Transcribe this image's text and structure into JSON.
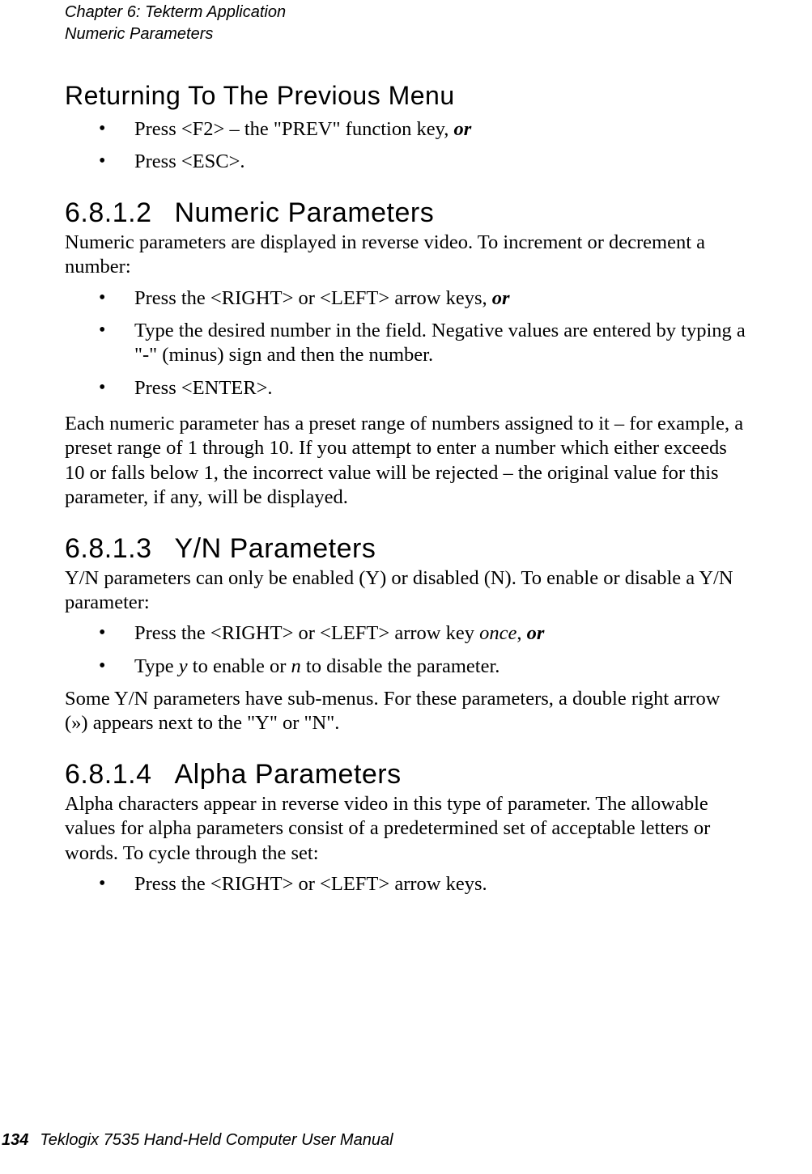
{
  "header": {
    "chapter": "Chapter  6:   Tekterm Application",
    "section": "Numeric Parameters"
  },
  "s_return": {
    "title": "Returning  To  The  Previous  Menu",
    "b1a": "Press <F2> – the \"PREV\" function key, ",
    "b1b": "or",
    "b2": "Press <ESC>."
  },
  "s6812": {
    "no": "6.8.1.2",
    "title": "Numeric  Parameters",
    "p1": "Numeric parameters are displayed in reverse video. To increment or decrement a number:",
    "b1a": "Press the <RIGHT> or <LEFT> arrow keys, ",
    "b1b": "or",
    "b2": "Type the desired number in the field. Negative values are entered by typing a \"-\" (minus) sign and then the number.",
    "b3": "Press <ENTER>.",
    "p2": "Each numeric parameter has a preset range of numbers assigned to it – for example, a preset range of 1 through 10. If you attempt to enter a number which either exceeds 10 or falls below 1, the incorrect value will be rejected – the original value for this parameter, if any, will be displayed."
  },
  "s6813": {
    "no": "6.8.1.3",
    "title": "Y/N  Parameters",
    "p1": "Y/N parameters can only be enabled (Y) or disabled (N). To enable or disable a Y/N parameter:",
    "b1a": "Press the <RIGHT> or <LEFT> arrow key ",
    "b1b": "once",
    "b1c": ", ",
    "b1d": "or",
    "b2a": "Type ",
    "b2b": "y",
    "b2c": " to enable or ",
    "b2d": "n",
    "b2e": " to disable the parameter.",
    "p2": "Some Y/N parameters have sub-menus. For these parameters, a double right arrow (») appears next to the \"Y\" or \"N\"."
  },
  "s6814": {
    "no": "6.8.1.4",
    "title": "Alpha  Parameters",
    "p1": "Alpha characters appear in reverse video in this type of parameter. The allowable values for alpha parameters consist of a predetermined set of acceptable letters or words. To cycle through the set:",
    "b1": "Press the <RIGHT> or <LEFT> arrow keys."
  },
  "footer": {
    "page": "134",
    "title": "Teklogix 7535 Hand-Held Computer User Manual"
  }
}
